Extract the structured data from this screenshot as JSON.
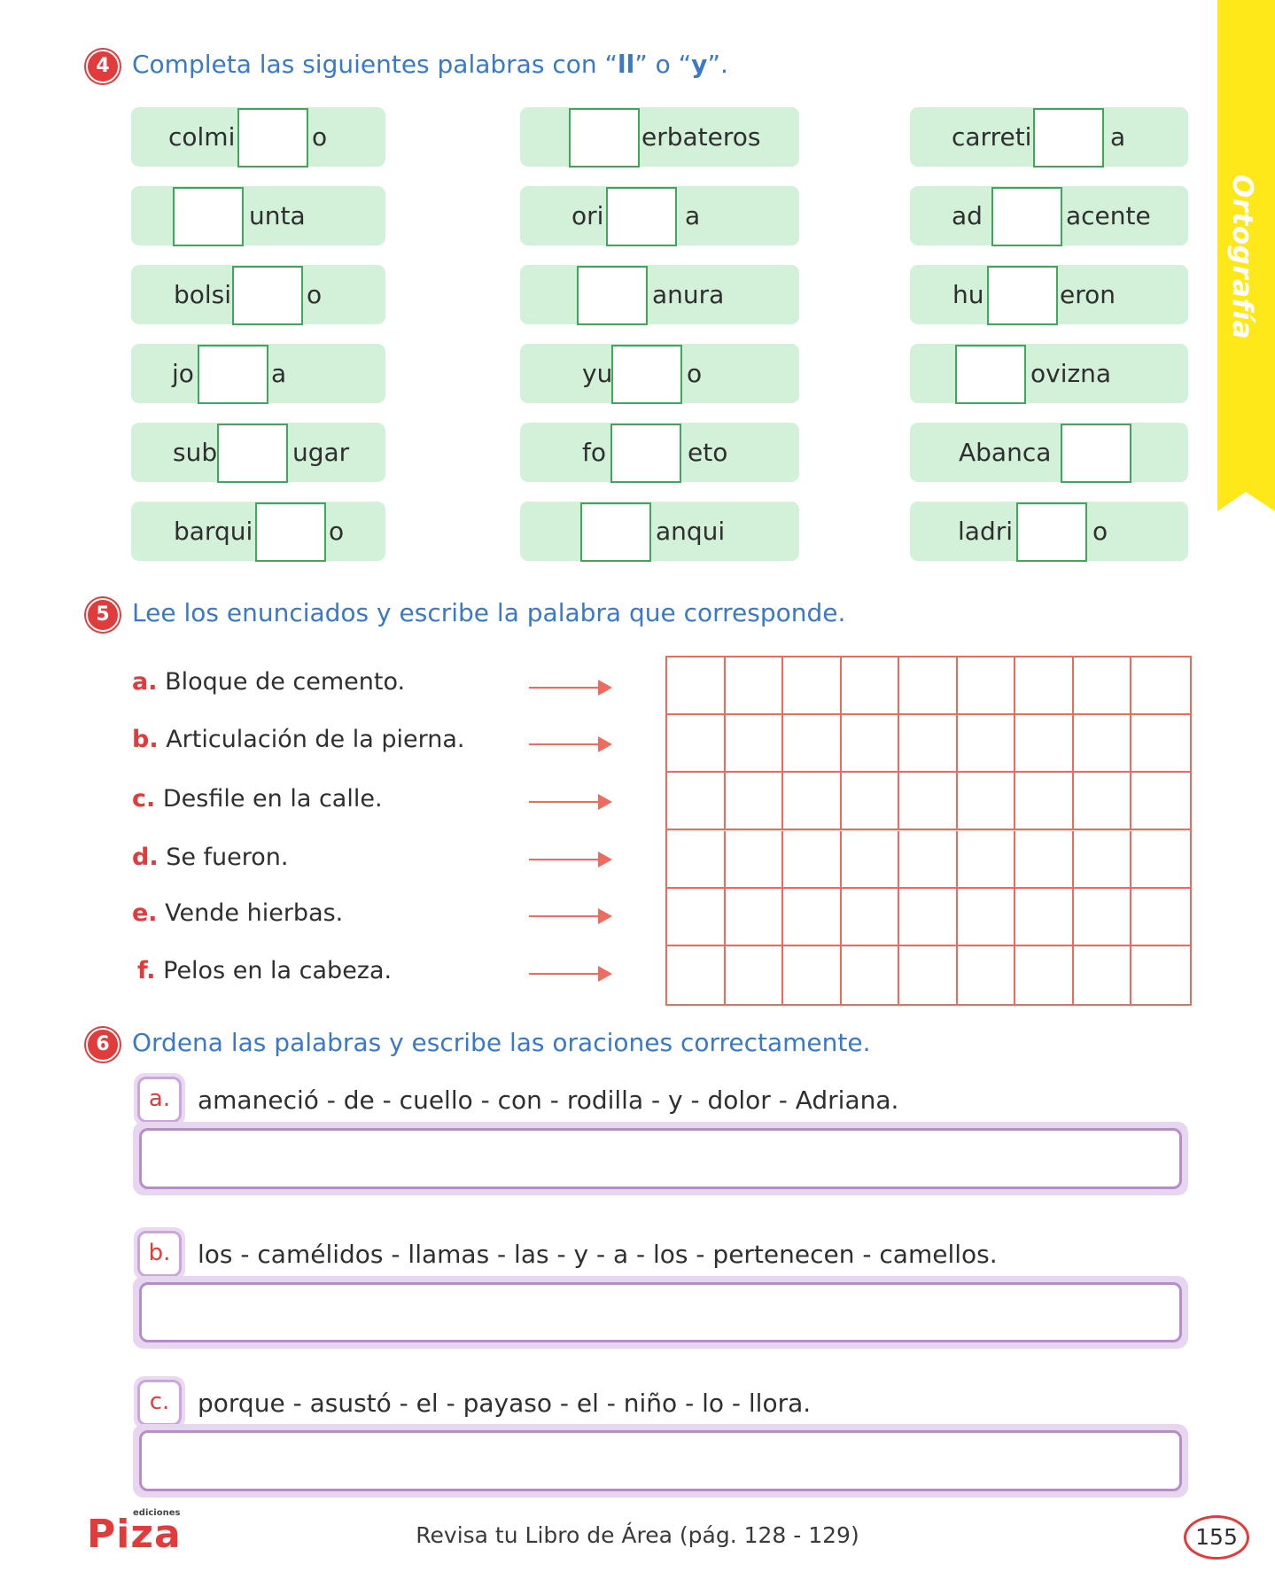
{
  "side_tab": {
    "label": "Ortografía",
    "color": "#ffe81a"
  },
  "section4": {
    "number": "4",
    "title_prefix": "Completa las siguientes palabras con “",
    "title_ll": "ll",
    "title_mid": "” o “",
    "title_y": "y",
    "title_suffix": "”.",
    "columns": [
      [
        {
          "before": "colmi",
          "after": "o"
        },
        {
          "before": "",
          "after": "unta"
        },
        {
          "before": "bolsi",
          "after": "o"
        },
        {
          "before": "jo",
          "after": "a"
        },
        {
          "before": "sub",
          "after": "ugar"
        },
        {
          "before": "barqui",
          "after": "o"
        }
      ],
      [
        {
          "before": "",
          "after": "erbateros"
        },
        {
          "before": "ori",
          "after": "a"
        },
        {
          "before": "",
          "after": "anura"
        },
        {
          "before": "yu",
          "after": "o"
        },
        {
          "before": "fo",
          "after": "eto"
        },
        {
          "before": "",
          "after": "anqui"
        }
      ],
      [
        {
          "before": "carreti",
          "after": "a"
        },
        {
          "before": "ad",
          "after": "acente"
        },
        {
          "before": "hu",
          "after": "eron"
        },
        {
          "before": "",
          "after": "ovizna"
        },
        {
          "before": "Abanca",
          "after": ""
        },
        {
          "before": "ladri",
          "after": "o"
        }
      ]
    ]
  },
  "section5": {
    "number": "5",
    "title": "Lee los enunciados y escribe la palabra que corresponde.",
    "clues": [
      {
        "letter": "a.",
        "text": "Bloque de cemento."
      },
      {
        "letter": "b.",
        "text": "Articulación de la pierna."
      },
      {
        "letter": "c.",
        "text": "Desfile en la calle."
      },
      {
        "letter": "d.",
        "text": "Se fueron."
      },
      {
        "letter": "e.",
        "text": "Vende hierbas."
      },
      {
        "letter": "f.",
        "text": "Pelos en la cabeza."
      }
    ],
    "grid": {
      "rows": 6,
      "cols": 9
    }
  },
  "section6": {
    "number": "6",
    "title": "Ordena las palabras y escribe las oraciones correctamente.",
    "items": [
      {
        "letter": "a.",
        "words": "amaneció - de - cuello - con - rodilla - y - dolor - Adriana."
      },
      {
        "letter": "b.",
        "words": "los - camélidos - llamas - las - y - a - los - pertenecen - camellos."
      },
      {
        "letter": "c.",
        "words": "porque - asustó - el - payaso - el - niño - lo - llora."
      }
    ]
  },
  "footer": {
    "brand": "Piza",
    "brand_small": "ediciones",
    "text": "Revisa tu Libro de Área (pág. 128 - 129)",
    "page": "155"
  }
}
